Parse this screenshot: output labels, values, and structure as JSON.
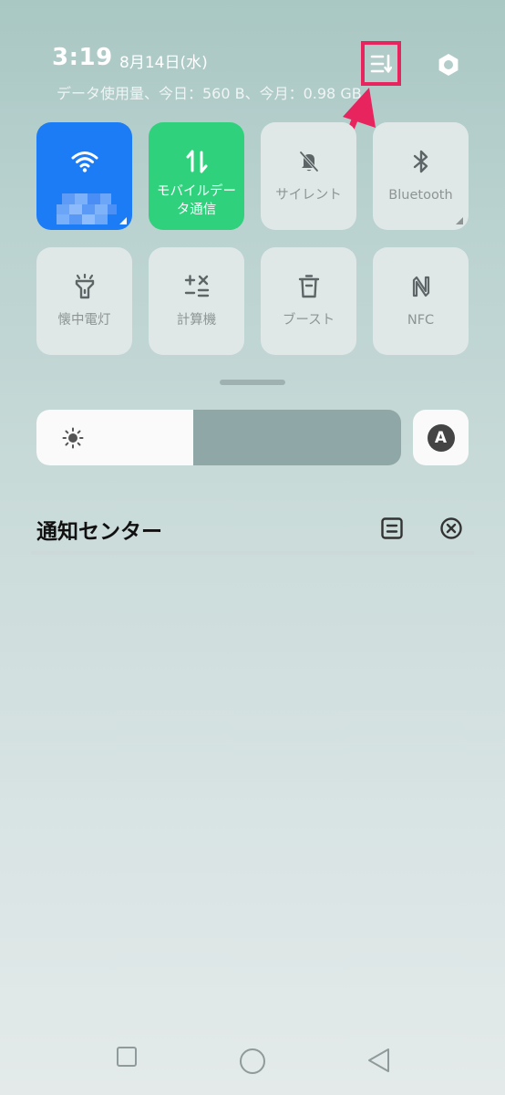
{
  "status": {
    "time": "3:19",
    "date": "8月14日(水)",
    "data_usage": "データ使用量、今日：560 B、今月：0.98 GB"
  },
  "header_icons": {
    "sort": "sort-list-icon",
    "settings": "settings-gear-icon"
  },
  "tiles": [
    {
      "label": "",
      "icon": "wifi-icon",
      "state": "on",
      "color": "#1c7cf5"
    },
    {
      "label": "モバイルデータ通信",
      "icon": "mobile-data-icon",
      "state": "on",
      "color": "#2fd17c"
    },
    {
      "label": "サイレント",
      "icon": "bell-off-icon",
      "state": "off"
    },
    {
      "label": "Bluetooth",
      "icon": "bluetooth-icon",
      "state": "off"
    },
    {
      "label": "懐中電灯",
      "icon": "flashlight-icon",
      "state": "off"
    },
    {
      "label": "計算機",
      "icon": "calculator-icon",
      "state": "off"
    },
    {
      "label": "ブースト",
      "icon": "trash-icon",
      "state": "off"
    },
    {
      "label": "NFC",
      "icon": "nfc-icon",
      "state": "off"
    }
  ],
  "brightness": {
    "level": 0.43,
    "auto_label": "A"
  },
  "notifications": {
    "title": "通知センター"
  },
  "colors": {
    "accent_highlight": "#e8245e",
    "wifi_tile": "#1c7cf5",
    "mobile_tile": "#2fd17c",
    "tile_off": "#dfe8e7"
  }
}
